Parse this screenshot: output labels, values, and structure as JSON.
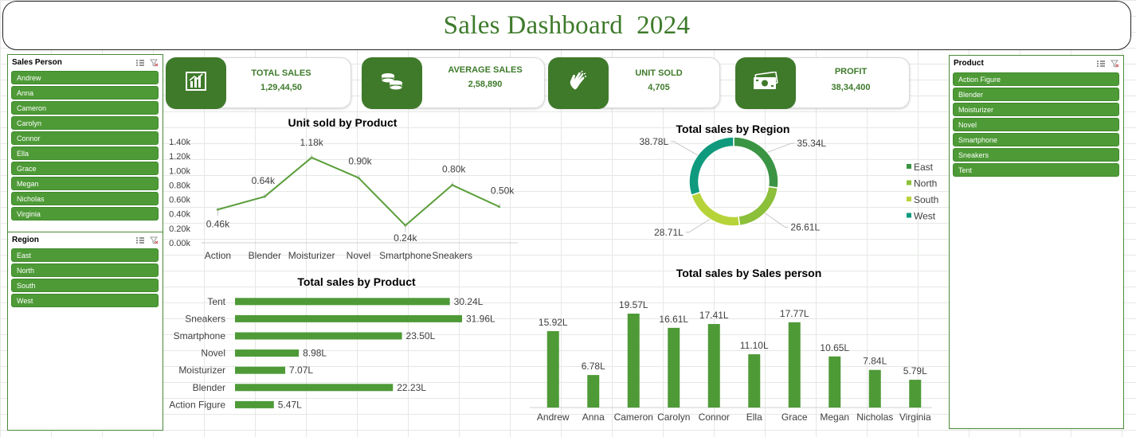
{
  "title": "Sales Dashboard  2024",
  "slicers": {
    "sales_person": {
      "title": "Sales Person",
      "items": [
        "Andrew",
        "Anna",
        "Cameron",
        "Carolyn",
        "Connor",
        "Ella",
        "Grace",
        "Megan",
        "Nicholas",
        "Virginia"
      ]
    },
    "region": {
      "title": "Region",
      "items": [
        "East",
        "North",
        "South",
        "West"
      ]
    },
    "product": {
      "title": "Product",
      "items": [
        "Action Figure",
        "Blender",
        "Moisturizer",
        "Novel",
        "Smartphone",
        "Sneakers",
        "Tent"
      ]
    }
  },
  "kpis": [
    {
      "label": "TOTAL SALES",
      "value": "1,29,44,50",
      "icon": "bar-chart-icon"
    },
    {
      "label": "AVERAGE SALES",
      "value": "2,58,890",
      "icon": "coins-icon"
    },
    {
      "label": "UNIT SOLD",
      "value": "4,705",
      "icon": "clapping-hands-icon"
    },
    {
      "label": "PROFIT",
      "value": "38,34,400",
      "icon": "money-icon"
    }
  ],
  "colors": {
    "accent": "#4e9a37",
    "dark_green": "#3f7a2b",
    "line": "#5a9e3a",
    "east": "#3a9443",
    "north": "#8cbf3a",
    "south": "#b7d33a",
    "west": "#0f9a7e"
  },
  "chart_data": [
    {
      "type": "line",
      "title": "Unit sold by Product",
      "categories": [
        "Action",
        "Blender",
        "Moisturizer",
        "Novel",
        "Smartphone",
        "Sneakers",
        ""
      ],
      "values": [
        0.46,
        0.64,
        1.18,
        0.9,
        0.24,
        0.8,
        0.5
      ],
      "data_labels": [
        "0.46k",
        "0.64k",
        "1.18k",
        "0.90k",
        "0.24k",
        "0.80k",
        "0.50k"
      ],
      "yticks": [
        "0.00k",
        "0.20k",
        "0.40k",
        "0.60k",
        "0.80k",
        "1.00k",
        "1.20k",
        "1.40k"
      ],
      "ylim": [
        0,
        1.4
      ],
      "grid": false
    },
    {
      "type": "pie",
      "title": "Total sales by Region",
      "categories": [
        "East",
        "North",
        "South",
        "West"
      ],
      "values": [
        35.34,
        26.61,
        28.71,
        38.78
      ],
      "data_labels": [
        "35.34L",
        "26.61L",
        "28.71L",
        "38.78L"
      ],
      "legend": "right"
    },
    {
      "type": "bar",
      "orientation": "horizontal",
      "title": "Total sales by Product",
      "categories": [
        "Tent",
        "Sneakers",
        "Smartphone",
        "Novel",
        "Moisturizer",
        "Blender",
        "Action Figure"
      ],
      "values": [
        30.24,
        31.96,
        23.5,
        8.98,
        7.07,
        22.23,
        5.47
      ],
      "data_labels": [
        "30.24L",
        "31.96L",
        "23.50L",
        "8.98L",
        "7.07L",
        "22.23L",
        "5.47L"
      ]
    },
    {
      "type": "bar",
      "title": "Total sales by Sales person",
      "categories": [
        "Andrew",
        "Anna",
        "Cameron",
        "Carolyn",
        "Connor",
        "Ella",
        "Grace",
        "Megan",
        "Nicholas",
        "Virginia"
      ],
      "values": [
        15.92,
        6.78,
        19.57,
        16.61,
        17.41,
        11.1,
        17.77,
        10.65,
        7.84,
        5.79
      ],
      "data_labels": [
        "15.92L",
        "6.78L",
        "19.57L",
        "16.61L",
        "17.41L",
        "11.10L",
        "17.77L",
        "10.65L",
        "7.84L",
        "5.79L"
      ]
    }
  ]
}
